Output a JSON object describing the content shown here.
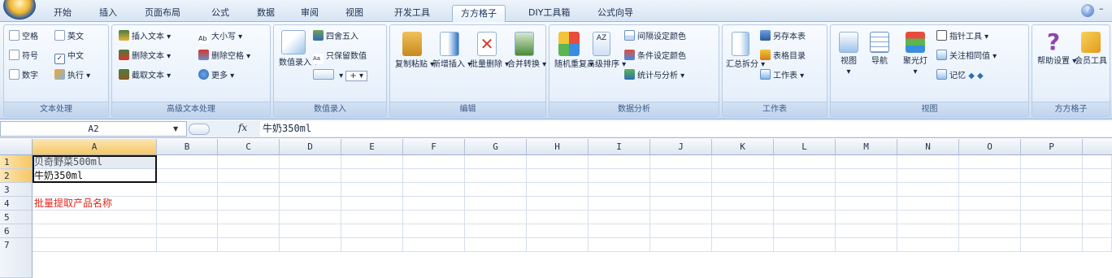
{
  "tabs": [
    "开始",
    "插入",
    "页面布局",
    "公式",
    "数据",
    "审阅",
    "视图",
    "开发工具",
    "方方格子",
    "DIY工具箱",
    "公式向导"
  ],
  "active_tab": "方方格子",
  "ribbon": {
    "text_group": {
      "label": "文本处理",
      "items": [
        "空格",
        "英文",
        "符号",
        "中文",
        "数字",
        "执行"
      ]
    },
    "adv_text_group": {
      "label": "高级文本处理",
      "items": [
        "插入文本",
        "大小写",
        "删除文本",
        "删除空格",
        "截取文本",
        "更多"
      ]
    },
    "data_entry_group": {
      "label": "数值录入",
      "items": [
        "四舍五入",
        "只保留数值",
        "数值录入"
      ]
    },
    "edit_group": {
      "label": "编辑",
      "items": [
        "复制粘贴",
        "新增插入",
        "批量删除",
        "合并转换"
      ]
    },
    "analysis_group": {
      "label": "数据分析",
      "items": [
        "随机重复",
        "高级排序",
        "间隔设定颜色",
        "条件设定颜色",
        "统计与分析"
      ]
    },
    "sheet_group": {
      "label": "工作表",
      "items": [
        "汇总拆分",
        "另存本表",
        "表格目录",
        "工作表"
      ]
    },
    "view_group": {
      "label": "视图",
      "items": [
        "视图",
        "导航",
        "聚光灯",
        "指针工具",
        "关注相同值",
        "记忆"
      ]
    },
    "ffgz_group": {
      "label": "方方格子",
      "items": [
        "帮助设置",
        "会员工具"
      ]
    }
  },
  "formula_bar": {
    "name_box": "A2",
    "fx": "fx",
    "content": "牛奶350ml"
  },
  "columns": [
    "A",
    "B",
    "C",
    "D",
    "E",
    "F",
    "G",
    "H",
    "I",
    "J",
    "K",
    "L",
    "M",
    "N",
    "O",
    "P"
  ],
  "rows": [
    "1",
    "2",
    "3",
    "4",
    "5",
    "6",
    "7"
  ],
  "cells": {
    "A1": "贝奇野菜500ml",
    "A2": "牛奶350ml",
    "A4": "批量提取产品名称"
  },
  "colors": {
    "accent_red": "#e2261c",
    "selection": "#f6c765"
  }
}
